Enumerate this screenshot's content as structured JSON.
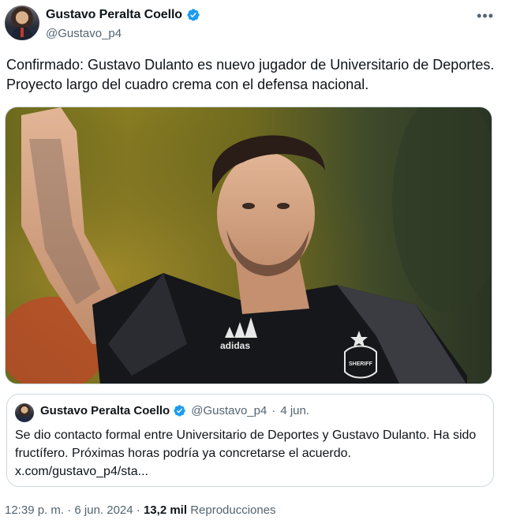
{
  "author": {
    "display_name": "Gustavo Peralta Coello",
    "handle": "@Gustavo_p4",
    "verified": true
  },
  "tweet": {
    "text": "Confirmado: Gustavo Dulanto es nuevo jugador de Universitario de Deportes. Proyecto largo del cuadro crema con el defensa nacional."
  },
  "media": {
    "description_icon": "photo-image",
    "jersey_brand_mark": "adidas",
    "crest_text": "SHERIFF"
  },
  "quote": {
    "display_name": "Gustavo Peralta Coello",
    "handle": "@Gustavo_p4",
    "separator": "·",
    "date": "4 jun.",
    "text": "Se dio contacto formal entre Universitario de Deportes y Gustavo Dulanto. Ha sido fructífero. Próximas horas podría ya concretarse el acuerdo. x.com/gustavo_p4/sta..."
  },
  "footer": {
    "time": "12:39 p. m.",
    "separator": "·",
    "date": "6 jun. 2024",
    "views_count": "13,2 mil",
    "views_label": "Reproducciones"
  },
  "colors": {
    "verified_blue": "#1d9bf0",
    "secondary_text": "#536471",
    "border": "#cfd9de"
  }
}
